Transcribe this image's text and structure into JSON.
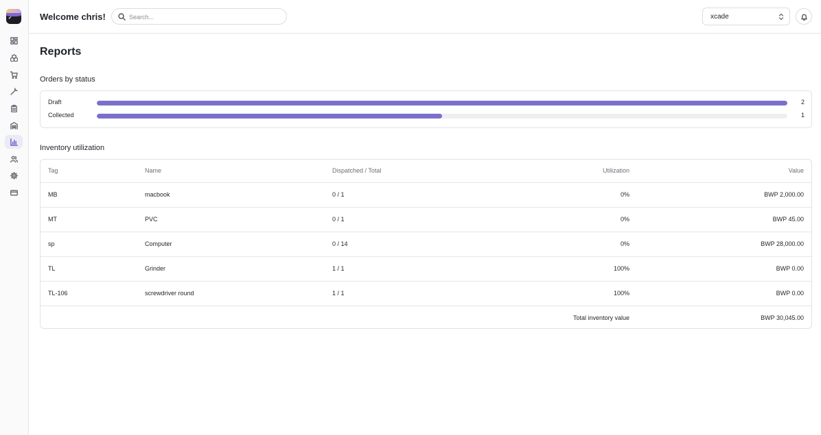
{
  "header": {
    "welcome": "Welcome chris!",
    "search_placeholder": "Search...",
    "org_selected": "xcade"
  },
  "sidebar": {
    "items": [
      {
        "name": "dashboard",
        "icon": "grid-icon"
      },
      {
        "name": "assets",
        "icon": "boxes-icon"
      },
      {
        "name": "orders",
        "icon": "cart-icon"
      },
      {
        "name": "tools",
        "icon": "wrench-icon"
      },
      {
        "name": "checklist",
        "icon": "clipboard-icon"
      },
      {
        "name": "warehouse",
        "icon": "warehouse-icon"
      },
      {
        "name": "reports",
        "icon": "bar-chart-icon",
        "active": true
      },
      {
        "name": "users",
        "icon": "users-icon"
      },
      {
        "name": "settings",
        "icon": "gear-icon"
      },
      {
        "name": "billing",
        "icon": "credit-card-icon"
      }
    ]
  },
  "page": {
    "title": "Reports"
  },
  "orders_by_status": {
    "title": "Orders by status",
    "accent": "#7b6fcb",
    "rows": [
      {
        "label": "Draft",
        "count": "2",
        "fraction": 1.0
      },
      {
        "label": "Collected",
        "count": "1",
        "fraction": 0.5
      }
    ]
  },
  "inventory": {
    "title": "Inventory utilization",
    "columns": {
      "tag": "Tag",
      "name": "Name",
      "dispatched": "Dispatched / Total",
      "utilization": "Utilization",
      "value": "Value"
    },
    "rows": [
      {
        "tag": "MB",
        "name": "macbook",
        "dispatched": "0 / 1",
        "utilization": "0%",
        "value": "BWP 2,000.00"
      },
      {
        "tag": "MT",
        "name": "PVC",
        "dispatched": "0 / 1",
        "utilization": "0%",
        "value": "BWP 45.00"
      },
      {
        "tag": "sp",
        "name": "Computer",
        "dispatched": "0 / 14",
        "utilization": "0%",
        "value": "BWP 28,000.00"
      },
      {
        "tag": "TL",
        "name": "Grinder",
        "dispatched": "1 / 1",
        "utilization": "100%",
        "value": "BWP 0.00"
      },
      {
        "tag": "TL-106",
        "name": "screwdriver round",
        "dispatched": "1 / 1",
        "utilization": "100%",
        "value": "BWP 0.00"
      }
    ],
    "total_label": "Total inventory value",
    "total_value": "BWP 30,045.00"
  }
}
